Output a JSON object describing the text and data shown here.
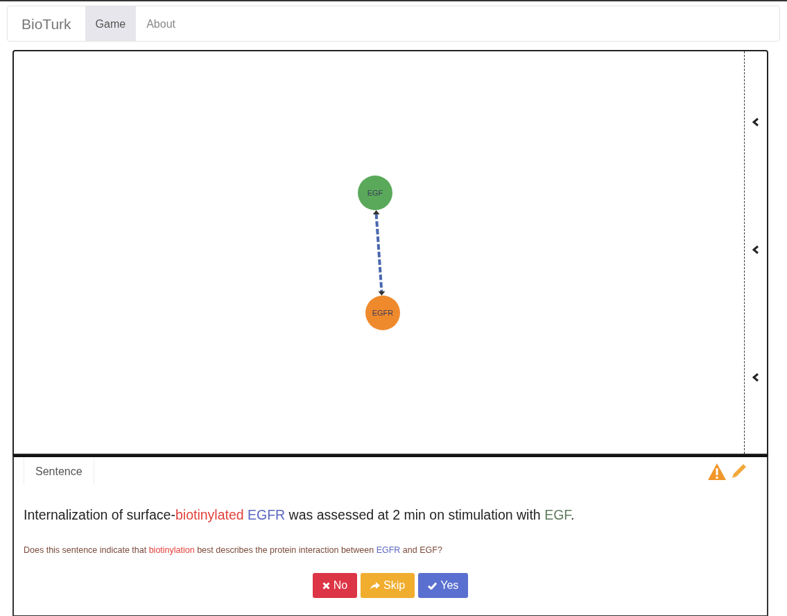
{
  "navbar": {
    "brand": "BioTurk",
    "tabs": [
      {
        "label": "Game",
        "selected": true
      },
      {
        "label": "About",
        "selected": false
      }
    ]
  },
  "graph": {
    "nodes": [
      {
        "label": "EGF",
        "color": "#5aa95a"
      },
      {
        "label": "EGFR",
        "color": "#ef8a2c"
      }
    ],
    "edges": [
      {
        "color": "#4a68b0"
      }
    ]
  },
  "sentence_panel": {
    "tab": "Sentence",
    "sentence": [
      {
        "kind": "plain",
        "text": "Internalization of surface-"
      },
      {
        "kind": "interaction",
        "text": "biotinylated"
      },
      {
        "kind": "protein_a",
        "text": " EGFR"
      },
      {
        "kind": "plain",
        "text": " was assessed at 2 min on stimulation with "
      },
      {
        "kind": "protein_b",
        "text": "EGF"
      },
      {
        "kind": "plain",
        "text": "."
      }
    ],
    "question": [
      {
        "kind": "plain",
        "text": "Does this sentence indicate that "
      },
      {
        "kind": "interaction",
        "text": "biotinylation"
      },
      {
        "kind": "plain",
        "text": " best describes the protein interaction between "
      },
      {
        "kind": "protein_a",
        "text": "EGFR"
      },
      {
        "kind": "plain",
        "text": " and EGF?"
      }
    ],
    "buttons": [
      {
        "kind": "no",
        "label": "No"
      },
      {
        "kind": "skip",
        "label": "Skip"
      },
      {
        "kind": "yes",
        "label": "Yes"
      }
    ]
  }
}
